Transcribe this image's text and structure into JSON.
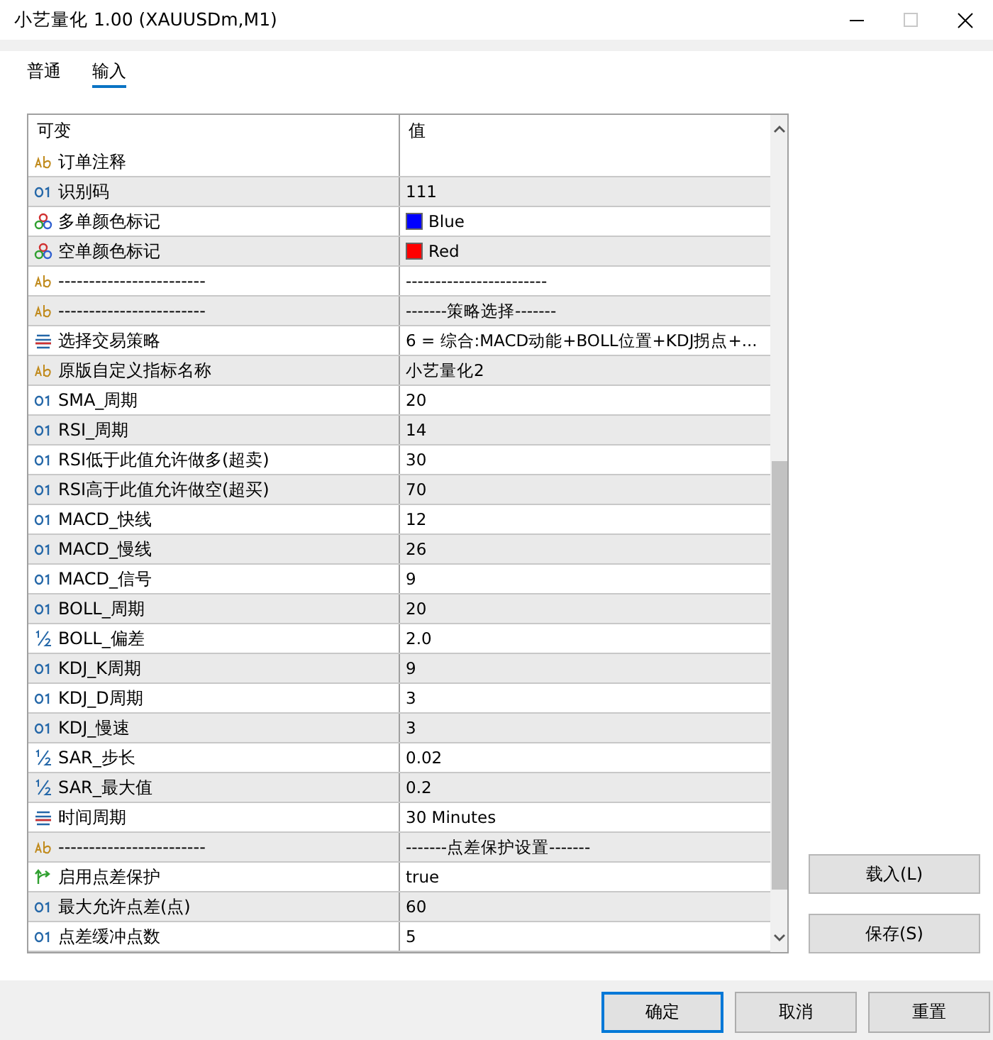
{
  "window": {
    "title": "小艺量化 1.00 (XAUUSDm,M1)"
  },
  "tabs": [
    {
      "label": "普通",
      "selected": false
    },
    {
      "label": "输入",
      "selected": true
    }
  ],
  "table": {
    "columns": [
      "可变",
      "值"
    ],
    "rows": [
      {
        "kind": "text",
        "name": "订单注释"
      },
      {
        "kind": "int",
        "name": "识别码",
        "value": "111"
      },
      {
        "kind": "color",
        "name": "多单颜色标记",
        "value": "Blue",
        "color": "#0000ff"
      },
      {
        "kind": "color",
        "name": "空单颜色标记",
        "value": "Red",
        "color": "#ff0000"
      },
      {
        "kind": "text",
        "name": "------------------------",
        "value": "------------------------"
      },
      {
        "kind": "text",
        "name": "------------------------",
        "value": "-------策略选择-------"
      },
      {
        "kind": "enum",
        "name": "选择交易策略",
        "value": "6 = 综合:MACD动能+BOLL位置+KDJ拐点+..."
      },
      {
        "kind": "text",
        "name": "原版自定义指标名称",
        "value": "小艺量化2"
      },
      {
        "kind": "int",
        "name": "SMA_周期",
        "value": "20"
      },
      {
        "kind": "int",
        "name": "RSI_周期",
        "value": "14"
      },
      {
        "kind": "int",
        "name": "RSI低于此值允许做多(超卖)",
        "value": "30"
      },
      {
        "kind": "int",
        "name": "RSI高于此值允许做空(超买)",
        "value": "70"
      },
      {
        "kind": "int",
        "name": "MACD_快线",
        "value": "12"
      },
      {
        "kind": "int",
        "name": "MACD_慢线",
        "value": "26"
      },
      {
        "kind": "int",
        "name": "MACD_信号",
        "value": "9"
      },
      {
        "kind": "int",
        "name": "BOLL_周期",
        "value": "20"
      },
      {
        "kind": "double",
        "name": "BOLL_偏差",
        "value": "2.0"
      },
      {
        "kind": "int",
        "name": "KDJ_K周期",
        "value": "9"
      },
      {
        "kind": "int",
        "name": "KDJ_D周期",
        "value": "3"
      },
      {
        "kind": "int",
        "name": "KDJ_慢速",
        "value": "3"
      },
      {
        "kind": "double",
        "name": "SAR_步长",
        "value": "0.02"
      },
      {
        "kind": "double",
        "name": "SAR_最大值",
        "value": "0.2"
      },
      {
        "kind": "enum",
        "name": "时间周期",
        "value": "30 Minutes"
      },
      {
        "kind": "text",
        "name": "------------------------",
        "value": "-------点差保护设置-------"
      },
      {
        "kind": "bool",
        "name": "启用点差保护",
        "value": "true"
      },
      {
        "kind": "int",
        "name": "最大允许点差(点)",
        "value": "60"
      },
      {
        "kind": "int",
        "name": "点差缓冲点数",
        "value": "5"
      }
    ]
  },
  "side_buttons": [
    "载入(L)",
    "保存(S)"
  ],
  "buttons": [
    "确定",
    "取消",
    "重置"
  ]
}
